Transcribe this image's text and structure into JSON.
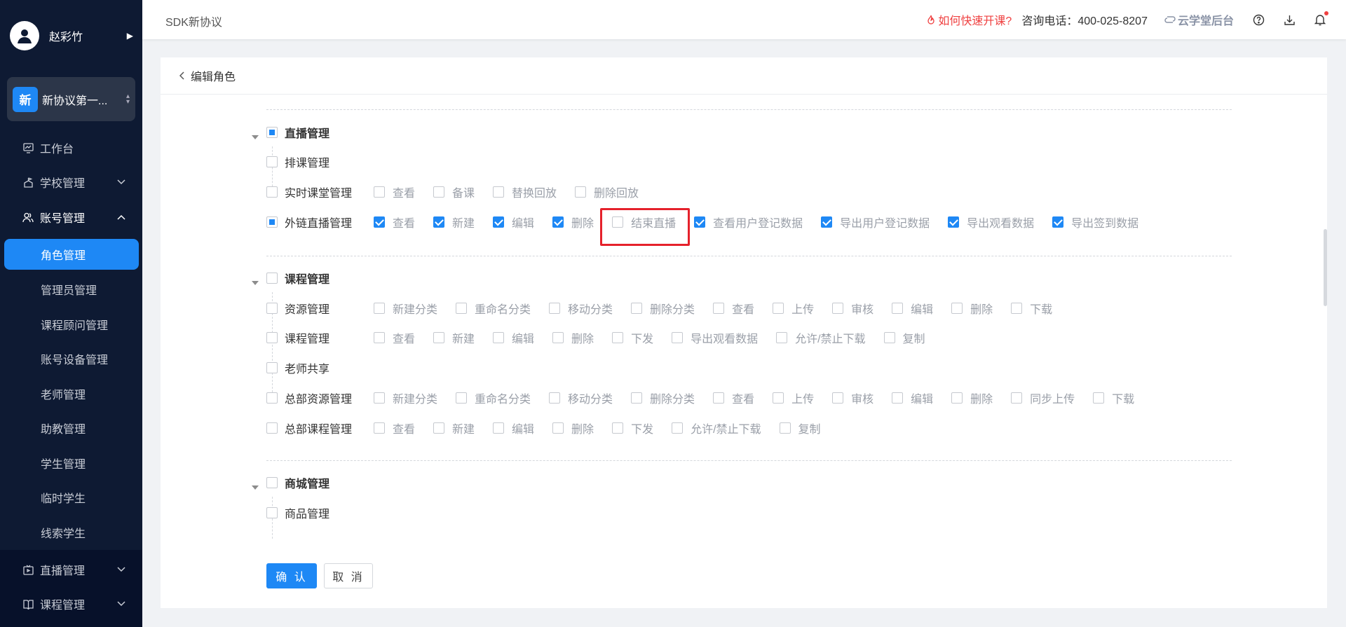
{
  "sidebar": {
    "user_name": "赵彩竹",
    "school_badge": "新",
    "school_name": "新协议第一...",
    "nav": {
      "workbench": "工作台",
      "school_mgmt": "学校管理",
      "account_mgmt": "账号管理",
      "live_mgmt": "直播管理",
      "course_mgmt": "课程管理"
    },
    "sub_items": [
      "角色管理",
      "管理员管理",
      "课程顾问管理",
      "账号设备管理",
      "老师管理",
      "助教管理",
      "学生管理",
      "临时学生",
      "线索学生"
    ]
  },
  "header": {
    "title": "SDK新协议",
    "quick_start": "如何快速开课?",
    "phone": "咨询电话：400-025-8207",
    "yun": "云学堂后台"
  },
  "page": {
    "back_label": "编辑角色",
    "confirm_label": "确 认",
    "cancel_label": "取 消"
  },
  "sections": {
    "live": {
      "title": "直播管理",
      "rows": {
        "schedule": "排课管理",
        "realtime": "实时课堂管理",
        "external": "外链直播管理"
      },
      "realtime_opts": [
        "查看",
        "备课",
        "替换回放",
        "删除回放"
      ],
      "external_opts": [
        "查看",
        "新建",
        "编辑",
        "删除",
        "结束直播",
        "查看用户登记数据",
        "导出用户登记数据",
        "导出观看数据",
        "导出签到数据"
      ]
    },
    "course": {
      "title": "课程管理",
      "rows": {
        "resource": "资源管理",
        "course": "课程管理",
        "teacher_share": "老师共享",
        "hq_resource": "总部资源管理",
        "hq_course": "总部课程管理"
      },
      "resource_opts": [
        "新建分类",
        "重命名分类",
        "移动分类",
        "删除分类",
        "查看",
        "上传",
        "审核",
        "编辑",
        "删除",
        "下载"
      ],
      "course_opts": [
        "查看",
        "新建",
        "编辑",
        "删除",
        "下发",
        "导出观看数据",
        "允许/禁止下载",
        "复制"
      ],
      "hq_resource_opts": [
        "新建分类",
        "重命名分类",
        "移动分类",
        "删除分类",
        "查看",
        "上传",
        "审核",
        "编辑",
        "删除",
        "同步上传",
        "下载"
      ],
      "hq_course_opts": [
        "查看",
        "新建",
        "编辑",
        "删除",
        "下发",
        "允许/禁止下载",
        "复制"
      ]
    },
    "mall": {
      "title": "商城管理",
      "rows": {
        "goods": "商品管理"
      }
    }
  },
  "colors": {
    "sidebar_bg": "#0e1a33",
    "accent": "#1e88f5",
    "highlight_box": "#e5212b"
  }
}
